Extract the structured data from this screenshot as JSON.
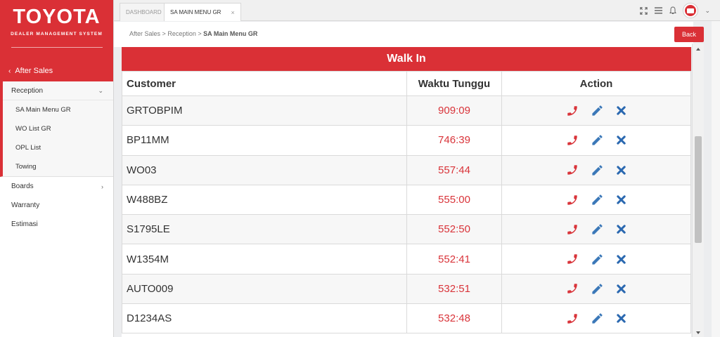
{
  "brand": {
    "logo": "TOYOTA",
    "subtitle": "DEALER MANAGEMENT SYSTEM"
  },
  "sidebar": {
    "back_label": "After Sales",
    "section": {
      "label": "Reception",
      "items": [
        {
          "label": "SA Main Menu GR"
        },
        {
          "label": "WO List GR"
        },
        {
          "label": "OPL List"
        },
        {
          "label": "Towing"
        }
      ]
    },
    "items": [
      {
        "label": "Boards"
      },
      {
        "label": "Warranty"
      },
      {
        "label": "Estimasi"
      }
    ]
  },
  "tabs": [
    {
      "label": "DASHBOARD"
    },
    {
      "label": "SA MAIN MENU GR",
      "close": "×"
    }
  ],
  "breadcrumb": {
    "part1": "After Sales",
    "part2": "Reception",
    "current": "SA Main Menu GR",
    "separator": ">"
  },
  "back_button": "Back",
  "panel": {
    "title": "Walk In",
    "columns": {
      "customer": "Customer",
      "wait": "Waktu Tunggu",
      "action": "Action"
    },
    "rows": [
      {
        "customer": "GRTOBPIM",
        "wait": "909:09"
      },
      {
        "customer": "BP11MM",
        "wait": "746:39"
      },
      {
        "customer": "WO03",
        "wait": "557:44"
      },
      {
        "customer": "W488BZ",
        "wait": "555:00"
      },
      {
        "customer": "S1795LE",
        "wait": "552:50"
      },
      {
        "customer": "W1354M",
        "wait": "552:41"
      },
      {
        "customer": "AUTO009",
        "wait": "532:51"
      },
      {
        "customer": "D1234AS",
        "wait": "532:48"
      }
    ]
  },
  "colors": {
    "accent": "#da3036",
    "edit": "#3b78b8",
    "delete": "#2a68b0"
  },
  "icons": {
    "call": "phone-icon",
    "edit": "pencil-icon",
    "delete": "close-icon"
  }
}
